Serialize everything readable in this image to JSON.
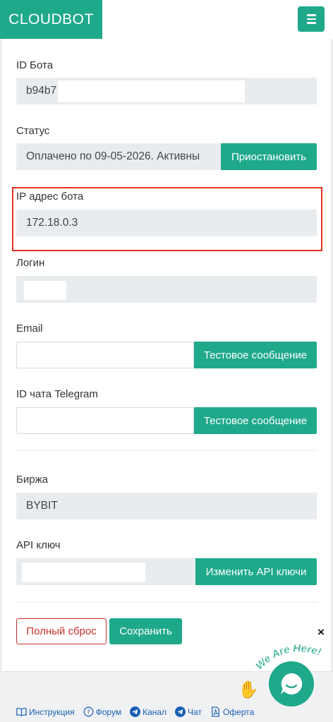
{
  "header": {
    "brand": "CLOUDBOT"
  },
  "fields": {
    "bot_id": {
      "label": "ID Бота",
      "value": "b94b7"
    },
    "status": {
      "label": "Статус",
      "value": "Оплачено по 09-05-2026. Активны",
      "button": "Приостановить"
    },
    "ip": {
      "label": "IP адрес бота",
      "value": "172.18.0.3"
    },
    "login": {
      "label": "Логин",
      "value": ""
    },
    "email": {
      "label": "Email",
      "value": "",
      "button": "Тестовое сообщение"
    },
    "telegram": {
      "label": "ID чата Telegram",
      "value": "",
      "button": "Тестовое сообщение"
    },
    "exchange": {
      "label": "Биржа",
      "value": "BYBIT"
    },
    "api_key": {
      "label": "API ключ",
      "value": "",
      "button": "Изменить API ключи"
    }
  },
  "actions": {
    "reset": "Полный сброс",
    "save": "Сохранить"
  },
  "footer": {
    "links": [
      "Инструкция",
      "Форум",
      "Канал",
      "Чат",
      "Оферта"
    ]
  },
  "chat_widget": {
    "banner": "We Are Here!",
    "close": "×"
  },
  "colors": {
    "accent": "#1fa98b",
    "highlight": "#e8311f",
    "danger": "#c9302c"
  }
}
